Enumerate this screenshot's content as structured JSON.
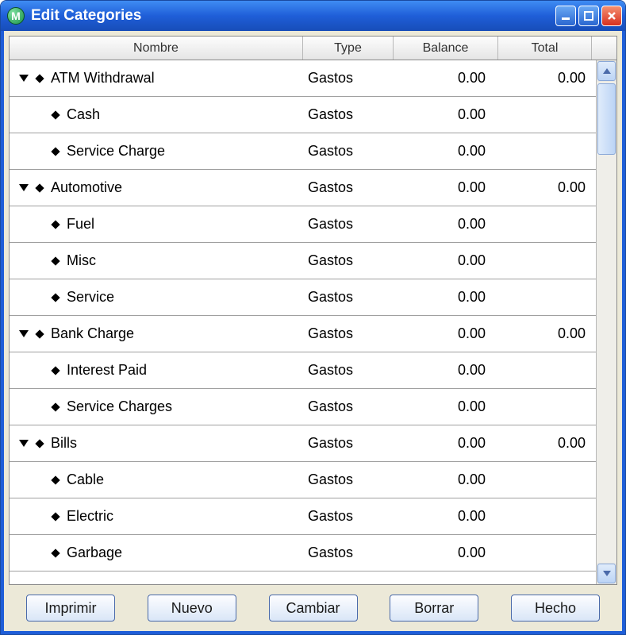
{
  "window": {
    "title": "Edit Categories",
    "app_icon_letter": "M"
  },
  "columns": {
    "name": "Nombre",
    "type": "Type",
    "balance": "Balance",
    "total": "Total"
  },
  "rows": [
    {
      "kind": "parent",
      "name": "ATM Withdrawal",
      "type": "Gastos",
      "balance": "0.00",
      "total": "0.00"
    },
    {
      "kind": "child",
      "name": "Cash",
      "type": "Gastos",
      "balance": "0.00",
      "total": ""
    },
    {
      "kind": "child",
      "name": "Service Charge",
      "type": "Gastos",
      "balance": "0.00",
      "total": ""
    },
    {
      "kind": "parent",
      "name": "Automotive",
      "type": "Gastos",
      "balance": "0.00",
      "total": "0.00"
    },
    {
      "kind": "child",
      "name": "Fuel",
      "type": "Gastos",
      "balance": "0.00",
      "total": ""
    },
    {
      "kind": "child",
      "name": "Misc",
      "type": "Gastos",
      "balance": "0.00",
      "total": ""
    },
    {
      "kind": "child",
      "name": "Service",
      "type": "Gastos",
      "balance": "0.00",
      "total": ""
    },
    {
      "kind": "parent",
      "name": "Bank Charge",
      "type": "Gastos",
      "balance": "0.00",
      "total": "0.00"
    },
    {
      "kind": "child",
      "name": "Interest Paid",
      "type": "Gastos",
      "balance": "0.00",
      "total": ""
    },
    {
      "kind": "child",
      "name": "Service Charges",
      "type": "Gastos",
      "balance": "0.00",
      "total": ""
    },
    {
      "kind": "parent",
      "name": "Bills",
      "type": "Gastos",
      "balance": "0.00",
      "total": "0.00"
    },
    {
      "kind": "child",
      "name": "Cable",
      "type": "Gastos",
      "balance": "0.00",
      "total": ""
    },
    {
      "kind": "child",
      "name": "Electric",
      "type": "Gastos",
      "balance": "0.00",
      "total": ""
    },
    {
      "kind": "child",
      "name": "Garbage",
      "type": "Gastos",
      "balance": "0.00",
      "total": ""
    }
  ],
  "buttons": {
    "print": "Imprimir",
    "new": "Nuevo",
    "change": "Cambiar",
    "delete": "Borrar",
    "done": "Hecho"
  }
}
